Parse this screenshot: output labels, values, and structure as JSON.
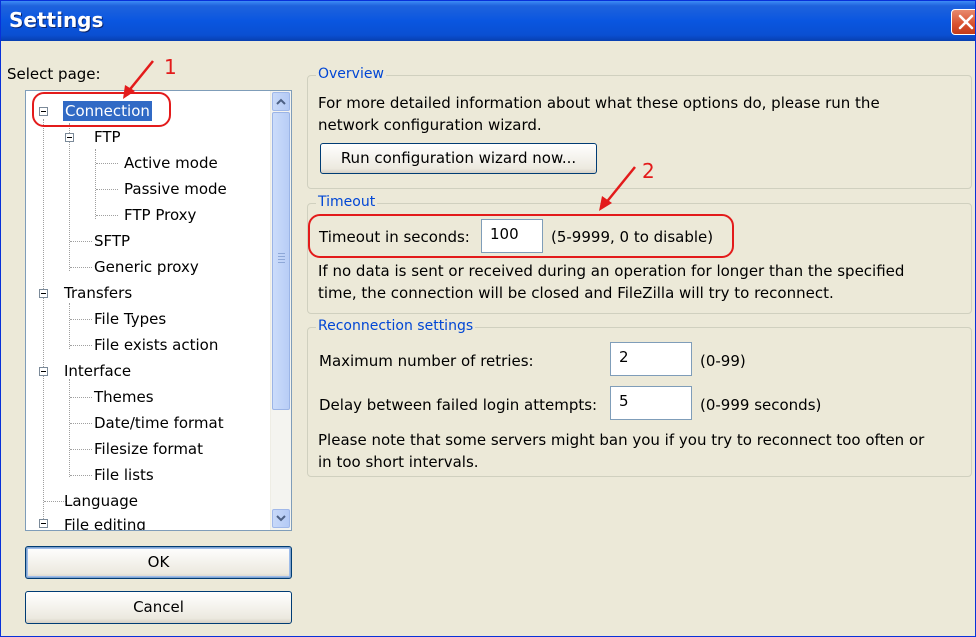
{
  "window": {
    "title": "Settings",
    "close_label": "close"
  },
  "left": {
    "select_label": "Select page:",
    "tree": [
      {
        "label": "Connection",
        "selected": true
      },
      {
        "label": "FTP"
      },
      {
        "label": "Active mode"
      },
      {
        "label": "Passive mode"
      },
      {
        "label": "FTP Proxy"
      },
      {
        "label": "SFTP"
      },
      {
        "label": "Generic proxy"
      },
      {
        "label": "Transfers"
      },
      {
        "label": "File Types"
      },
      {
        "label": "File exists action"
      },
      {
        "label": "Interface"
      },
      {
        "label": "Themes"
      },
      {
        "label": "Date/time format"
      },
      {
        "label": "Filesize format"
      },
      {
        "label": "File lists"
      },
      {
        "label": "Language"
      },
      {
        "label": "File editing"
      }
    ],
    "ok_label": "OK",
    "cancel_label": "Cancel"
  },
  "overview": {
    "title": "Overview",
    "text_line1": "For more detailed information about what these options do, please run the",
    "text_line2": "network configuration wizard.",
    "wizard_button": "Run configuration wizard now..."
  },
  "timeout": {
    "title": "Timeout",
    "label": "Timeout in seconds:",
    "value": "100",
    "hint": "(5-9999, 0 to disable)",
    "desc_line1": "If no data is sent or received during an operation for longer than the specified",
    "desc_line2": "time, the connection will be closed and FileZilla will try to reconnect."
  },
  "reconnection": {
    "title": "Reconnection settings",
    "retries_label": "Maximum number of retries:",
    "retries_value": "2",
    "retries_hint": "(0-99)",
    "delay_label": "Delay between failed login attempts:",
    "delay_value": "5",
    "delay_hint": "(0-999 seconds)",
    "note_line1": "Please note that some servers might ban you if you try to reconnect too often or",
    "note_line2": "in too short intervals."
  },
  "annotations": {
    "marker1": "1",
    "marker2": "2",
    "color": "#e31b1b"
  },
  "colors": {
    "accent": "#316ac5",
    "titlebar": "#0a56e0",
    "group_title": "#0046d5"
  }
}
